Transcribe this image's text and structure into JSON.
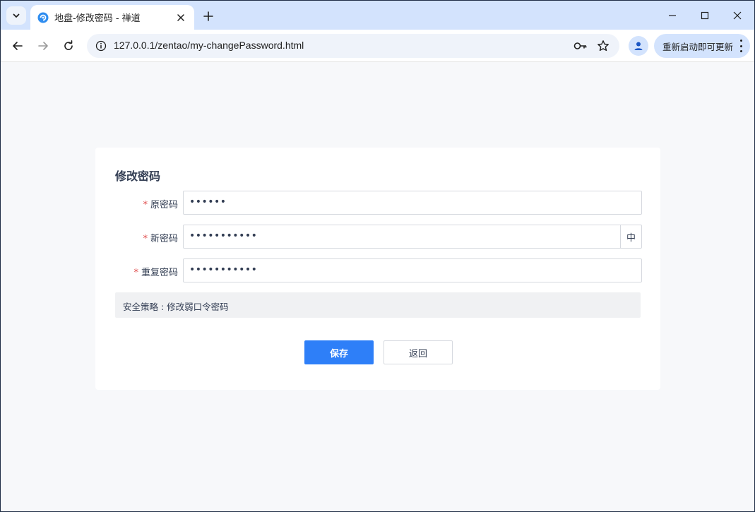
{
  "browser": {
    "tab_title": "地盘-修改密码 - 禅道",
    "url": "127.0.0.1/zentao/my-changePassword.html",
    "update_label": "重新启动即可更新",
    "accent_color": "#d3e3fd"
  },
  "form": {
    "title": "修改密码",
    "required_mark": "*",
    "fields": [
      {
        "label": "原密码",
        "value": "••••••"
      },
      {
        "label": "新密码",
        "value": "•••••••••••",
        "addon": "中"
      },
      {
        "label": "重复密码",
        "value": "•••••••••••"
      }
    ],
    "notice": "安全策略 : 修改弱口令密码",
    "save_label": "保存",
    "back_label": "返回",
    "primary_color": "#2e7ff8"
  }
}
